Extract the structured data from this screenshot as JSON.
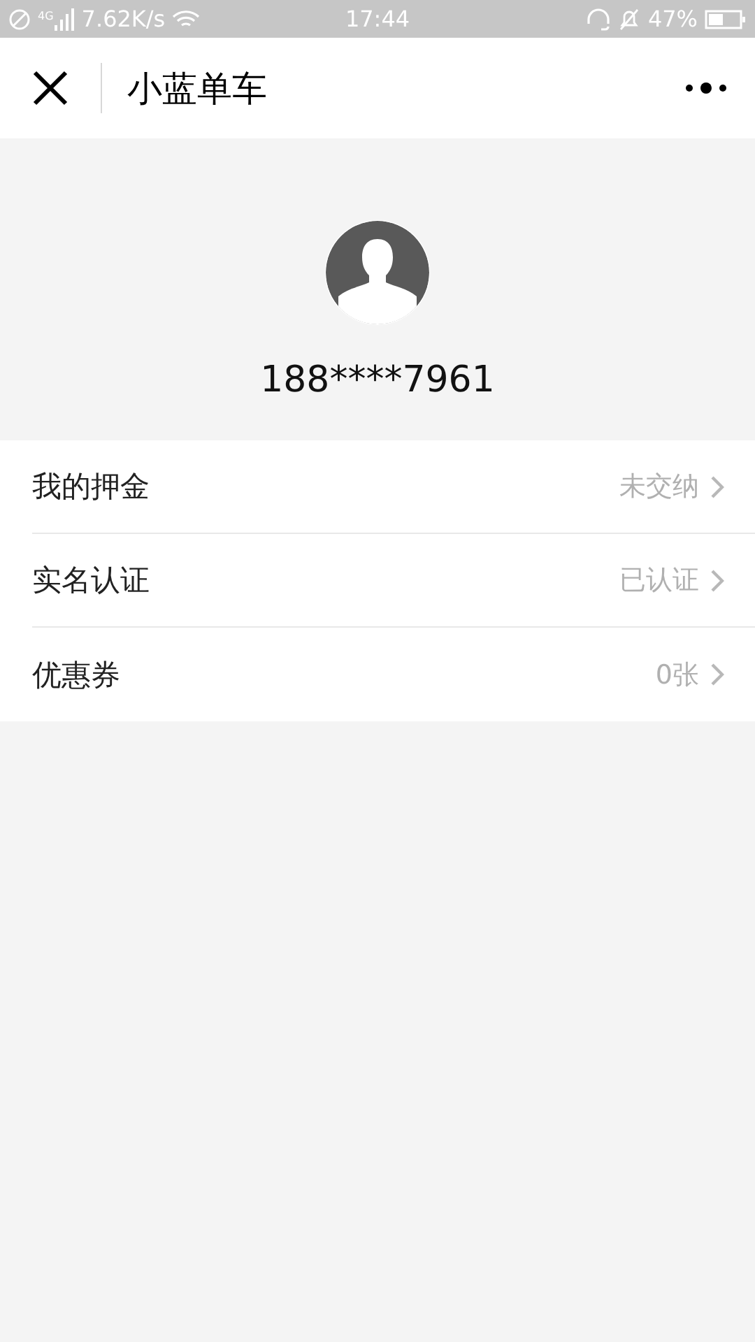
{
  "status_bar": {
    "network": "4G",
    "speed": "7.62K/s",
    "time": "17:44",
    "battery": "47%"
  },
  "nav_bar": {
    "title": "小蓝单车"
  },
  "profile": {
    "phone": "188****7961"
  },
  "menu": [
    {
      "label": "我的押金",
      "value": "未交纳"
    },
    {
      "label": "实名认证",
      "value": "已认证"
    },
    {
      "label": "优惠券",
      "value": "0张"
    }
  ]
}
